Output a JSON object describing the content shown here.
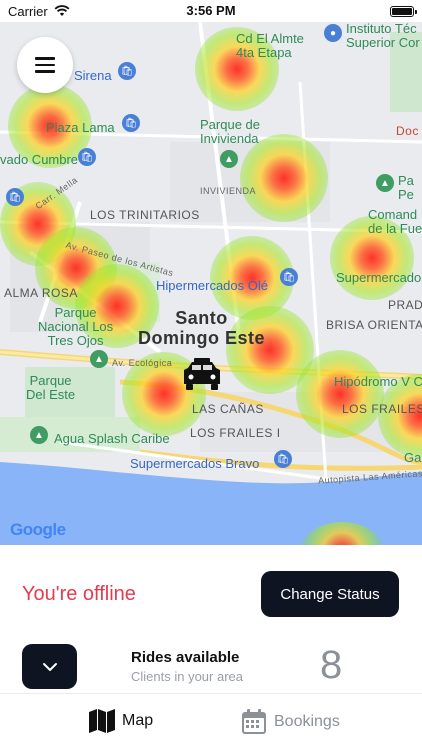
{
  "status_bar": {
    "carrier": "Carrier",
    "time": "3:56 PM"
  },
  "map": {
    "labels": {
      "cd_el_almte": "Cd El Almte\n4ta Etapa",
      "instituto": "Instituto Téc\nSuperior Cor",
      "sirena": "Sirena",
      "plaza_lama": "Plaza Lama",
      "parque_invivienda": "Parque de\nInvivienda",
      "doc": "Doc",
      "vado_cumbre": "vado Cumbre",
      "invivienda": "INVIVIENDA",
      "parque_right": "Pa\nPe",
      "los_trinitarios": "LOS TRINITARIOS",
      "comando": "Comand\nde la Fuer",
      "carr_mella": "Carr. Mella",
      "av_paseo": "Av. Paseo de los Artistas",
      "hipermercados": "Hipermercados Olé",
      "supermercado_right": "Supermercado",
      "alma_rosa": "ALMA ROSA",
      "parque_nacional": "Parque\nNacional Los\nTres Ojos",
      "santo_domingo": "Santo\nDomingo Este",
      "prada": "PRADA",
      "brisa": "BRISA ORIENTAL",
      "av_ecologica": "Av. Ecológica",
      "parque_del_este": "Parque\nDel Este",
      "hipodromo": "Hipódromo V C",
      "las_canas": "LAS CAÑAS",
      "los_frailes_r": "LOS FRAILES",
      "los_frailes_i": "LOS FRAILES I",
      "agua_splash": "Agua Splash Caribe",
      "supermercados_bravo": "Supermercados Bravo",
      "autopista": "Autopista Las Américas",
      "ga": "Ga",
      "google": "Google"
    }
  },
  "panel": {
    "status_text": "You're offline",
    "change_status_label": "Change Status",
    "rides_title": "Rides available",
    "rides_subtitle": "Clients in your area",
    "rides_count": "8"
  },
  "tabs": [
    {
      "label": "Map",
      "icon": "map-icon",
      "active": true
    },
    {
      "label": "Bookings",
      "icon": "calendar-icon",
      "active": false
    }
  ],
  "colors": {
    "offline": "#e23d4f",
    "button_dark": "#0f1422",
    "water": "#8ab4f8"
  }
}
